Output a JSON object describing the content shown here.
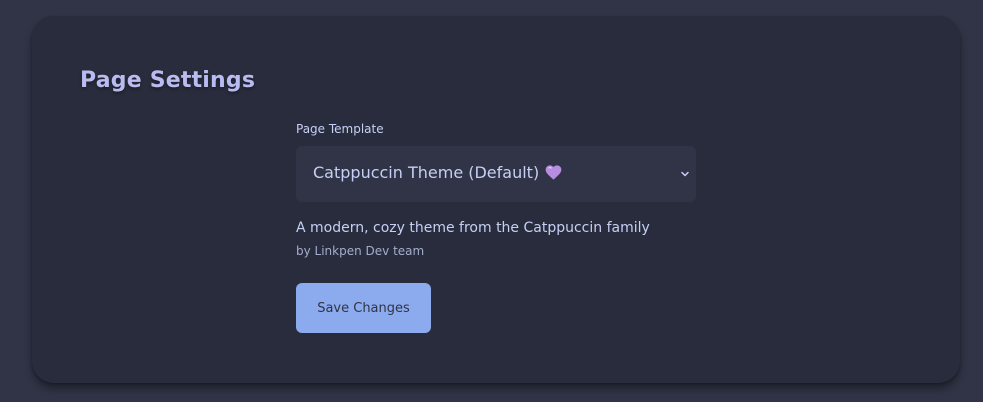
{
  "header": {
    "title": "Page Settings"
  },
  "template_field": {
    "label": "Page Template",
    "selected": "Catppuccin Theme (Default)",
    "selected_icon": "purple-heart-icon"
  },
  "template_info": {
    "description": "A modern, cozy theme from the Catppuccin family",
    "author": "by Linkpen Dev team"
  },
  "actions": {
    "save_label": "Save Changes"
  },
  "colors": {
    "background": "#303446",
    "card": "#292c3c",
    "title": "#babbf1",
    "text": "#c6d0f5",
    "muted_text": "#a5adce",
    "accent": "#8caaee",
    "heart": "#ca9ee6"
  }
}
